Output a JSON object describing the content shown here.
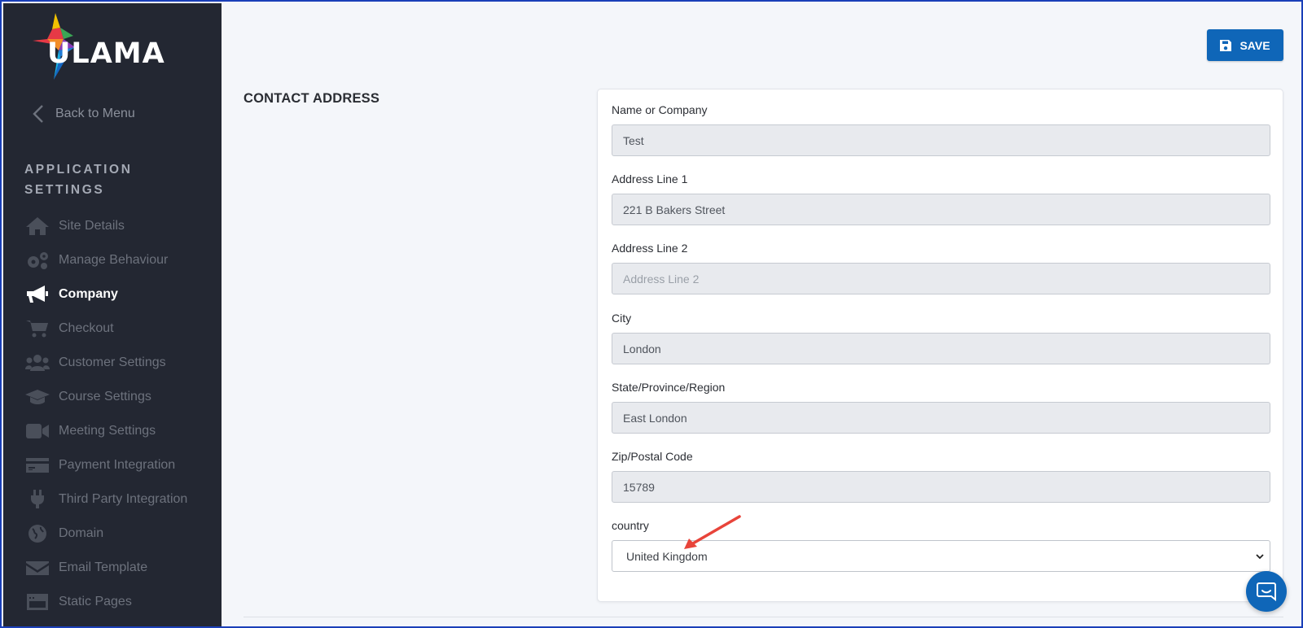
{
  "brand": {
    "name": "ULAMA"
  },
  "sidebar": {
    "back_label": "Back to Menu",
    "section_title": "APPLICATION SETTINGS",
    "items": [
      {
        "label": "Site Details",
        "icon": "home-icon",
        "active": false
      },
      {
        "label": "Manage Behaviour",
        "icon": "gears-icon",
        "active": false
      },
      {
        "label": "Company",
        "icon": "megaphone-icon",
        "active": true
      },
      {
        "label": "Checkout",
        "icon": "cart-icon",
        "active": false
      },
      {
        "label": "Customer Settings",
        "icon": "users-icon",
        "active": false
      },
      {
        "label": "Course Settings",
        "icon": "graduation-cap-icon",
        "active": false
      },
      {
        "label": "Meeting Settings",
        "icon": "video-icon",
        "active": false
      },
      {
        "label": "Payment Integration",
        "icon": "credit-card-icon",
        "active": false
      },
      {
        "label": "Third Party Integration",
        "icon": "plug-icon",
        "active": false
      },
      {
        "label": "Domain",
        "icon": "globe-icon",
        "active": false
      },
      {
        "label": "Email Template",
        "icon": "envelope-icon",
        "active": false
      },
      {
        "label": "Static Pages",
        "icon": "window-icon",
        "active": false
      }
    ]
  },
  "toolbar": {
    "save_label": "SAVE"
  },
  "form": {
    "heading": "CONTACT ADDRESS",
    "name": {
      "label": "Name or Company",
      "value": "Test"
    },
    "address1": {
      "label": "Address Line 1",
      "value": "221 B Bakers Street"
    },
    "address2": {
      "label": "Address Line 2",
      "value": "",
      "placeholder": "Address Line 2"
    },
    "city": {
      "label": "City",
      "value": "London"
    },
    "state": {
      "label": "State/Province/Region",
      "value": "East London"
    },
    "zip": {
      "label": "Zip/Postal Code",
      "value": "15789"
    },
    "country": {
      "label": "country",
      "value": "United Kingdom"
    }
  },
  "colors": {
    "accent": "#0f66b8",
    "sidebar_bg": "#232732",
    "annotation_arrow": "#e8443a"
  }
}
